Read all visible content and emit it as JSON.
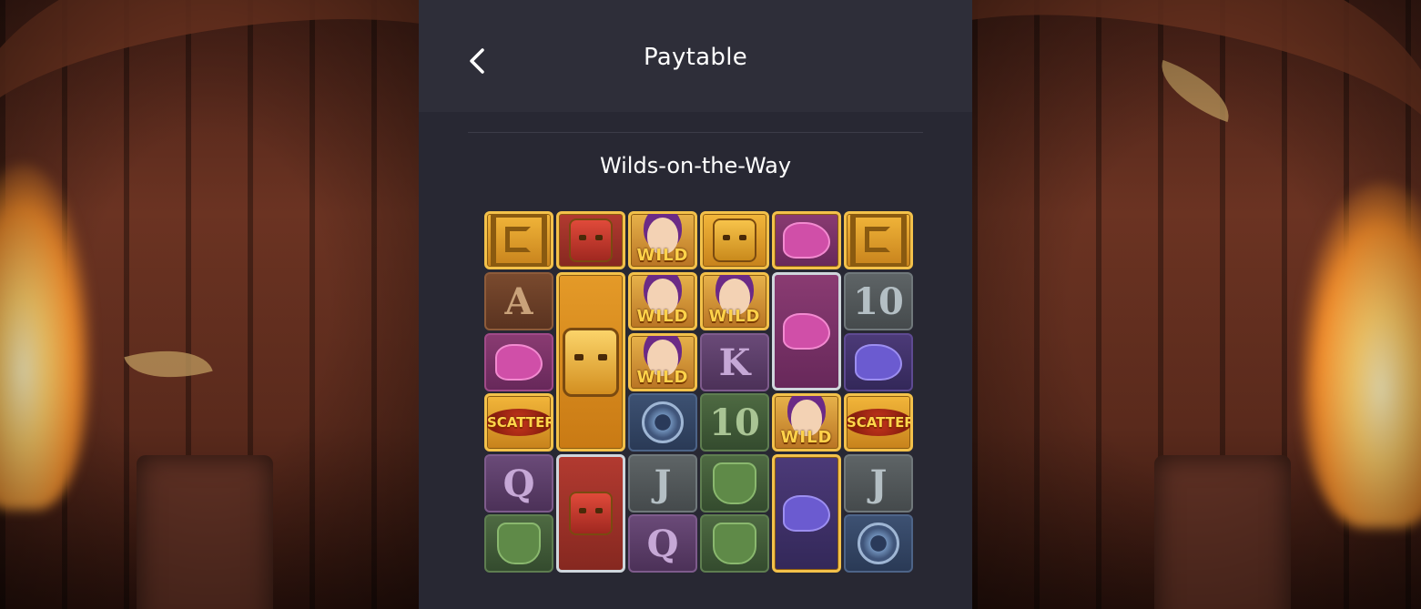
{
  "header": {
    "title": "Paytable",
    "back_icon": "chevron-left-icon"
  },
  "section": {
    "title": "Wilds-on-the-Way"
  },
  "grid": {
    "columns": 6,
    "rows": 6,
    "cells": [
      {
        "symbol": "spiral-gold",
        "label": ""
      },
      {
        "symbol": "red-mask",
        "label": ""
      },
      {
        "symbol": "wild-queen",
        "label": "WILD"
      },
      {
        "symbol": "gold-mask",
        "label": ""
      },
      {
        "symbol": "pink-bird",
        "label": ""
      },
      {
        "symbol": "spiral-gold",
        "label": ""
      },
      {
        "symbol": "letter",
        "label": "A"
      },
      {
        "symbol": "tall-gold-mask",
        "label": ""
      },
      {
        "symbol": "wild-queen",
        "label": "WILD"
      },
      {
        "symbol": "wild-queen",
        "label": "WILD"
      },
      {
        "symbol": "tall-pink-bird",
        "label": ""
      },
      {
        "symbol": "letter",
        "label": "10"
      },
      {
        "symbol": "pink-bird",
        "label": ""
      },
      {
        "symbol": "wild-queen",
        "label": "WILD"
      },
      {
        "symbol": "letter",
        "label": "K"
      },
      {
        "symbol": "blue-bird",
        "label": ""
      },
      {
        "symbol": "scatter",
        "label": "SCATTER"
      },
      {
        "symbol": "blue-gem",
        "label": ""
      },
      {
        "symbol": "letter",
        "label": "10"
      },
      {
        "symbol": "wild-queen",
        "label": "WILD"
      },
      {
        "symbol": "scatter",
        "label": "SCATTER"
      },
      {
        "symbol": "letter",
        "label": "Q"
      },
      {
        "symbol": "tall-red-mask",
        "label": ""
      },
      {
        "symbol": "letter",
        "label": "J"
      },
      {
        "symbol": "green-shield",
        "label": ""
      },
      {
        "symbol": "tall-blue-bird",
        "label": ""
      },
      {
        "symbol": "letter",
        "label": "J"
      },
      {
        "symbol": "green-shield",
        "label": ""
      },
      {
        "symbol": "letter",
        "label": "Q"
      },
      {
        "symbol": "green-shield",
        "label": ""
      },
      {
        "symbol": "blue-gem",
        "label": ""
      }
    ]
  }
}
